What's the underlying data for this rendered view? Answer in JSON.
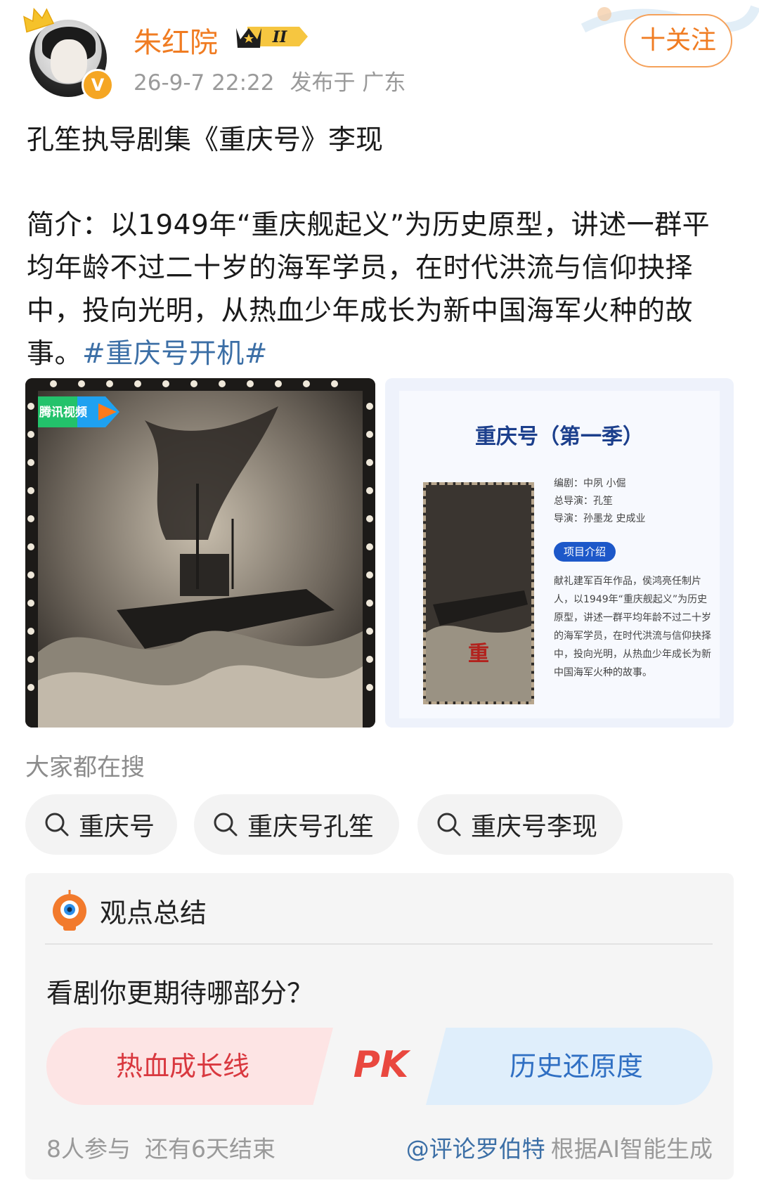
{
  "header": {
    "username": "朱红院",
    "rank_badge": "II",
    "vip_badge": "V",
    "timestamp": "26-9-7 22:22",
    "location": "发布于 广东",
    "follow_label": "十关注"
  },
  "post": {
    "title": "孔笙执导剧集《重庆号》李现",
    "body": "简介：以1949年“重庆舰起义”为历史原型，讲述一群平均年龄不过二十岁的海军学员，在时代洪流与信仰抉择中，投向光明，从热血少年成长为新中国海军火种的故事。",
    "hashtag": "#重庆号开机#"
  },
  "images": {
    "left": {
      "logo_label": "腾讯视频"
    },
    "right": {
      "title": "重庆号（第一季）",
      "credits": [
        "编剧：中夙 小倔",
        "总导演：孔笙",
        "导演：孙墨龙 史成业"
      ],
      "tag": "项目介绍",
      "description": "献礼建军百年作品，侯鸿亮任制片人，以1949年“重庆舰起义”为历史原型，讲述一群平均年龄不过二十岁的海军学员，在时代洪流与信仰抉择中，投向光明，从热血少年成长为新中国海军火种的故事。"
    }
  },
  "search": {
    "heading": "大家都在搜",
    "chips": [
      "重庆号",
      "重庆号孔笙",
      "重庆号李现"
    ]
  },
  "summary": {
    "title": "观点总结",
    "question": "看剧你更期待哪部分？",
    "option_left": "热血成长线",
    "pk_label": "PK",
    "option_right": "历史还原度",
    "participants": "8人参与",
    "time_left": "还有6天结束",
    "ai_handle": "@评论罗伯特",
    "ai_note": "根据AI智能生成"
  },
  "colors": {
    "username": "#f07c22",
    "hashtag": "#3c6fa6",
    "pk_left": "#d9383f",
    "pk_right": "#2f6fc3"
  }
}
